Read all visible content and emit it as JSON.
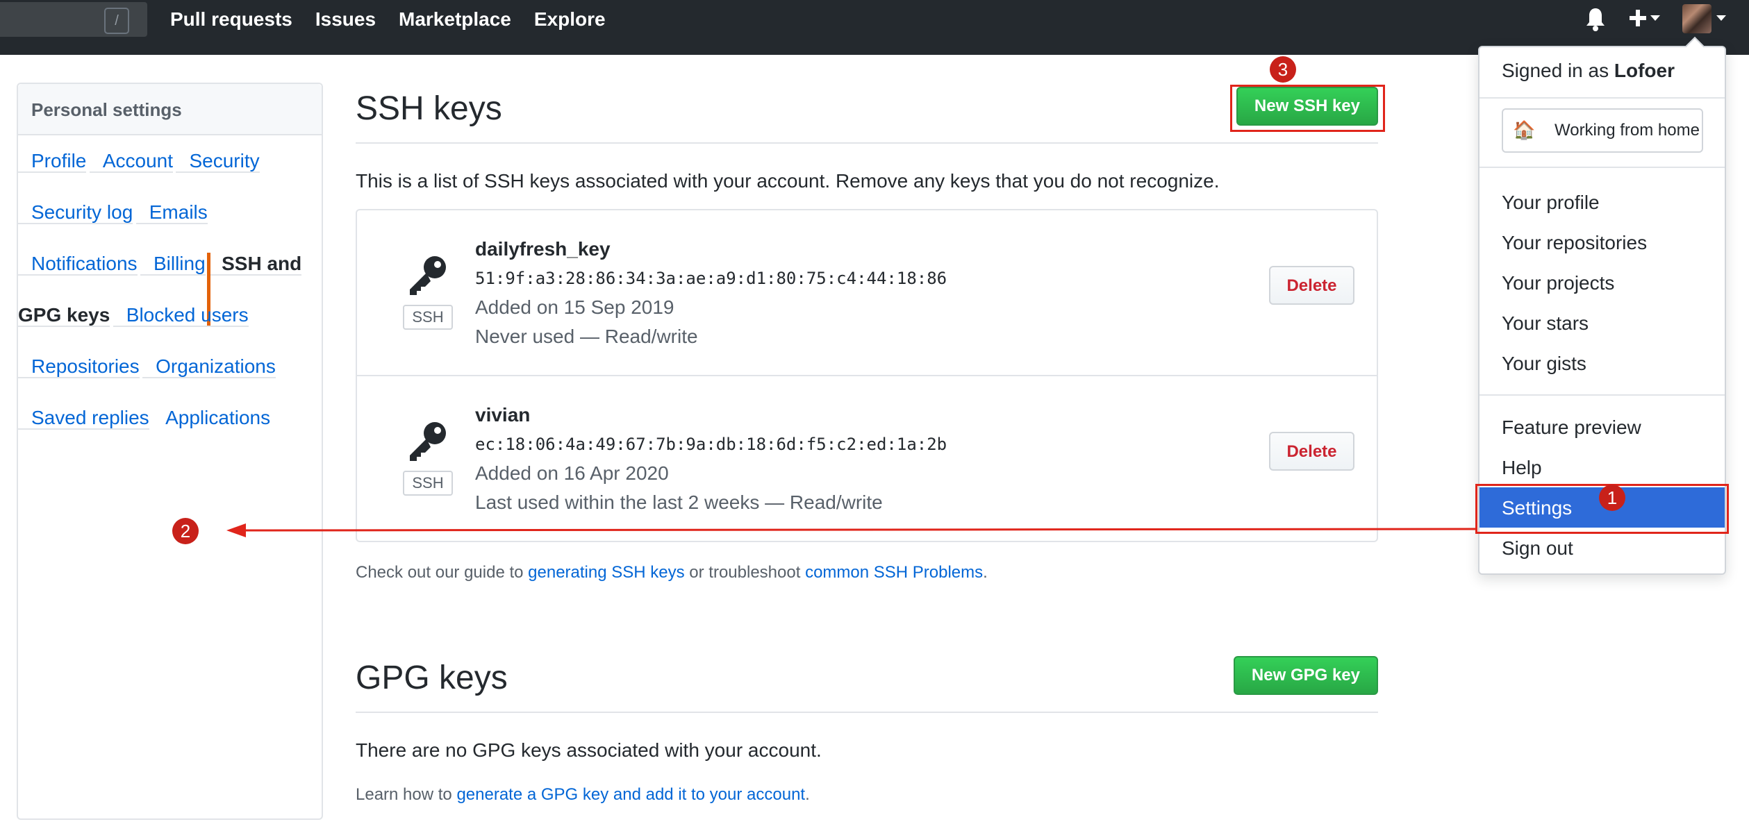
{
  "header": {
    "search_key": "/",
    "nav": [
      "Pull requests",
      "Issues",
      "Marketplace",
      "Explore"
    ],
    "icons": [
      "bell-icon",
      "plus-icon",
      "caret-down-icon"
    ]
  },
  "sidebar": {
    "title": "Personal settings",
    "items": [
      {
        "label": "Profile"
      },
      {
        "label": "Account"
      },
      {
        "label": "Security"
      },
      {
        "label": "Security log"
      },
      {
        "label": "Emails"
      },
      {
        "label": "Notifications"
      },
      {
        "label": "Billing"
      },
      {
        "label": "SSH and GPG keys",
        "selected": true
      },
      {
        "label": "Blocked users"
      },
      {
        "label": "Repositories"
      },
      {
        "label": "Organizations"
      },
      {
        "label": "Saved replies"
      },
      {
        "label": "Applications"
      }
    ]
  },
  "ssh": {
    "title": "SSH keys",
    "new_button": "New SSH key",
    "intro": "This is a list of SSH keys associated with your account. Remove any keys that you do not recognize.",
    "keys": [
      {
        "title": "dailyfresh_key",
        "fingerprint": "51:9f:a3:28:86:34:3a:ae:a9:d1:80:75:c4:44:18:86",
        "added": "Added on 15 Sep 2019",
        "usage": "Never used — Read/write",
        "tag": "SSH",
        "delete_label": "Delete"
      },
      {
        "title": "vivian",
        "fingerprint": "ec:18:06:4a:49:67:7b:9a:db:18:6d:f5:c2:ed:1a:2b",
        "added": "Added on 16 Apr 2020",
        "usage": "Last used within the last 2 weeks — Read/write",
        "tag": "SSH",
        "delete_label": "Delete"
      }
    ],
    "guide": {
      "prefix": "Check out our guide to ",
      "link1": "generating SSH keys",
      "middle": " or troubleshoot ",
      "link2": "common SSH Problems",
      "suffix": "."
    }
  },
  "gpg": {
    "title": "GPG keys",
    "new_button": "New GPG key",
    "none_text": "There are no GPG keys associated with your account.",
    "learn": {
      "prefix": "Learn how to ",
      "link": "generate a GPG key and add it to your account",
      "suffix": "."
    }
  },
  "dropdown": {
    "signed_prefix": "Signed in as ",
    "username": "Lofoer",
    "status_emoji": "🏠",
    "status_text": "Working from home",
    "items_group1": [
      "Your profile",
      "Your repositories",
      "Your projects",
      "Your stars",
      "Your gists"
    ],
    "items_group2": [
      "Feature preview",
      "Help",
      "Settings",
      "Sign out"
    ]
  },
  "annotations": {
    "badges": [
      "1",
      "2",
      "3"
    ],
    "color": "#e0251b"
  },
  "colors": {
    "header_bg": "#24292e",
    "link": "#0366d6",
    "green_button": "#28a745",
    "delete_text": "#cb2431",
    "selected_accent": "#e36209",
    "dropdown_highlight": "#2e6bd9"
  }
}
